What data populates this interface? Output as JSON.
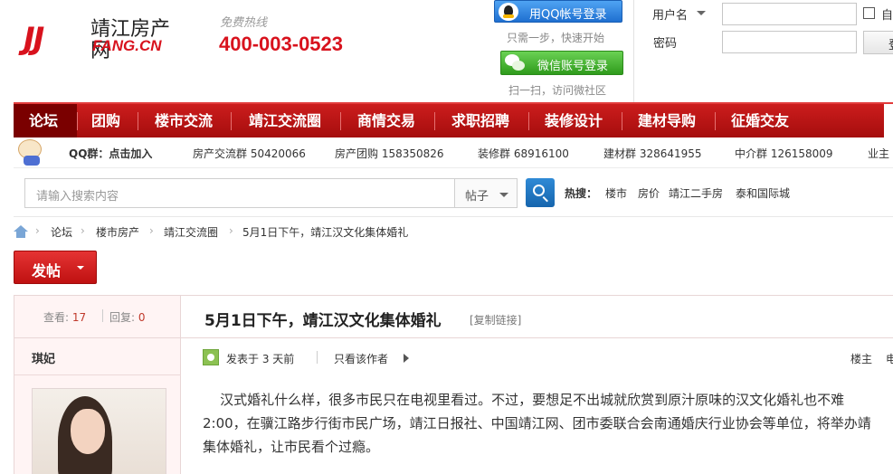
{
  "header": {
    "logo_jj": "JJ",
    "logo_cn": "靖江房产网",
    "logo_domain": "FANG.CN",
    "hotline_label": "免费热线",
    "hotline_number": "400-003-0523",
    "qq_login_label": "用QQ帐号登录",
    "qq_hint": "只需一步，快速开始",
    "wechat_login_label": "微信账号登录",
    "wechat_hint": "扫一扫，访问微社区",
    "username_label": "用户名",
    "remember_label": "自",
    "password_label": "密码",
    "login_button": "登"
  },
  "nav": {
    "items": [
      {
        "label": "论坛"
      },
      {
        "label": "团购"
      },
      {
        "label": "楼市交流"
      },
      {
        "label": "靖江交流圈"
      },
      {
        "label": "商情交易"
      },
      {
        "label": "求职招聘"
      },
      {
        "label": "装修设计"
      },
      {
        "label": "建材导购"
      },
      {
        "label": "征婚交友"
      }
    ]
  },
  "qq_groups": {
    "label": "QQ群：点击加入",
    "groups": [
      "房产交流群 50420066",
      "房产团购 158350826",
      "装修群 68916100",
      "建材群 328641955",
      "中介群 126158009",
      "业主"
    ]
  },
  "search": {
    "placeholder": "请输入搜索内容",
    "scope": "帖子",
    "hot_label": "热搜：",
    "hot_links": [
      "楼市",
      "房价",
      "靖江二手房",
      "泰和国际城"
    ]
  },
  "breadcrumb": [
    "论坛",
    "楼市房产",
    "靖江交流圈",
    "5月1日下午，靖江汉文化集体婚礼"
  ],
  "post_button": "发帖",
  "thread": {
    "views_label": "查看:",
    "views": "17",
    "replies_label": "回复:",
    "replies": "0",
    "title": "5月1日下午，靖江汉文化集体婚礼",
    "copy_link": "[复制链接]",
    "author": "琪妃",
    "posted_at": "发表于 3 天前",
    "only_author": "只看该作者",
    "floor_label": "楼主",
    "extra_label": "电",
    "body_lines": [
      "    汉式婚礼什么样，很多市民只在电视里看过。不过，要想足不出城就欣赏到原汁原味的汉文化婚礼也不难",
      "2:00，在骥江路步行街市民广场，靖江日报社、中国靖江网、团市委联合会南通婚庆行业协会等单位，将举办靖",
      "集体婚礼，让市民看个过瘾。"
    ]
  }
}
